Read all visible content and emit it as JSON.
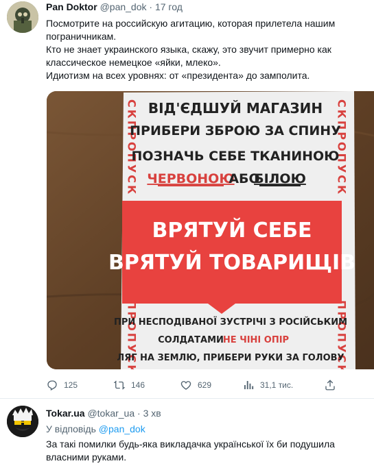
{
  "tweet1": {
    "display_name": "Pan Doktor",
    "handle": "@pan_dok",
    "separator": "·",
    "time": "17 год",
    "lines": [
      "Посмотрите на российскую агитацию, которая прилетела нашим пограничникам.",
      "Кто не знает украинского языка, скажу, это звучит примерно как классическое немецкое «яйки, млеко».",
      "Идиотизм на всех уровнях: от «президента» до замполита."
    ],
    "leaflet": {
      "side_text": "СКПРОПУСК",
      "side_text_bottom": "ПРОПУСК",
      "line1": "ВІД'ЄДШУЙ МАГАЗИН",
      "line2": "ПРИБЕРИ ЗБРОЮ ЗА СПИНУ",
      "line3": "ПОЗНАЧЬ СЕБЕ ТКАНИНОЮ",
      "line4_a": "ЧЕРВОНОЮ",
      "line4_b": "АБО",
      "line4_c": "БІЛОЮ",
      "banner1": "ВРЯТУЙ СЕБЕ",
      "banner2": "ВРЯТУЙ ТОВАРИЩІВ",
      "line5": "ПРИ НЕСПОДІВАНОЇ ЗУСТРІЧІ З РОСІЙСЬКИМ",
      "line6_a": "СОЛДАТАМИ",
      "line6_b": "НЕ ЧІНІ ОПІР",
      "line7": "ЛЯГ НА ЗЕМЛЮ, ПРИБЕРИ РУКИ ЗА ГОЛОВУ",
      "red": "#e23a3a",
      "banner_red": "#e8423f"
    },
    "actions": {
      "replies": "125",
      "retweets": "146",
      "likes": "629",
      "views": "31,1 тис."
    }
  },
  "tweet2": {
    "display_name": "Tokar.ua",
    "handle": "@tokar_ua",
    "separator": "·",
    "time": "3 хв",
    "reply_prefix": "У відповідь",
    "reply_handle": "@pan_dok",
    "text": "За такі помилки будь-яка викладачка української їх би подушила власними руками."
  },
  "colors": {
    "link": "#1d9bf0",
    "secondary": "#536471",
    "text": "#0f1419"
  }
}
